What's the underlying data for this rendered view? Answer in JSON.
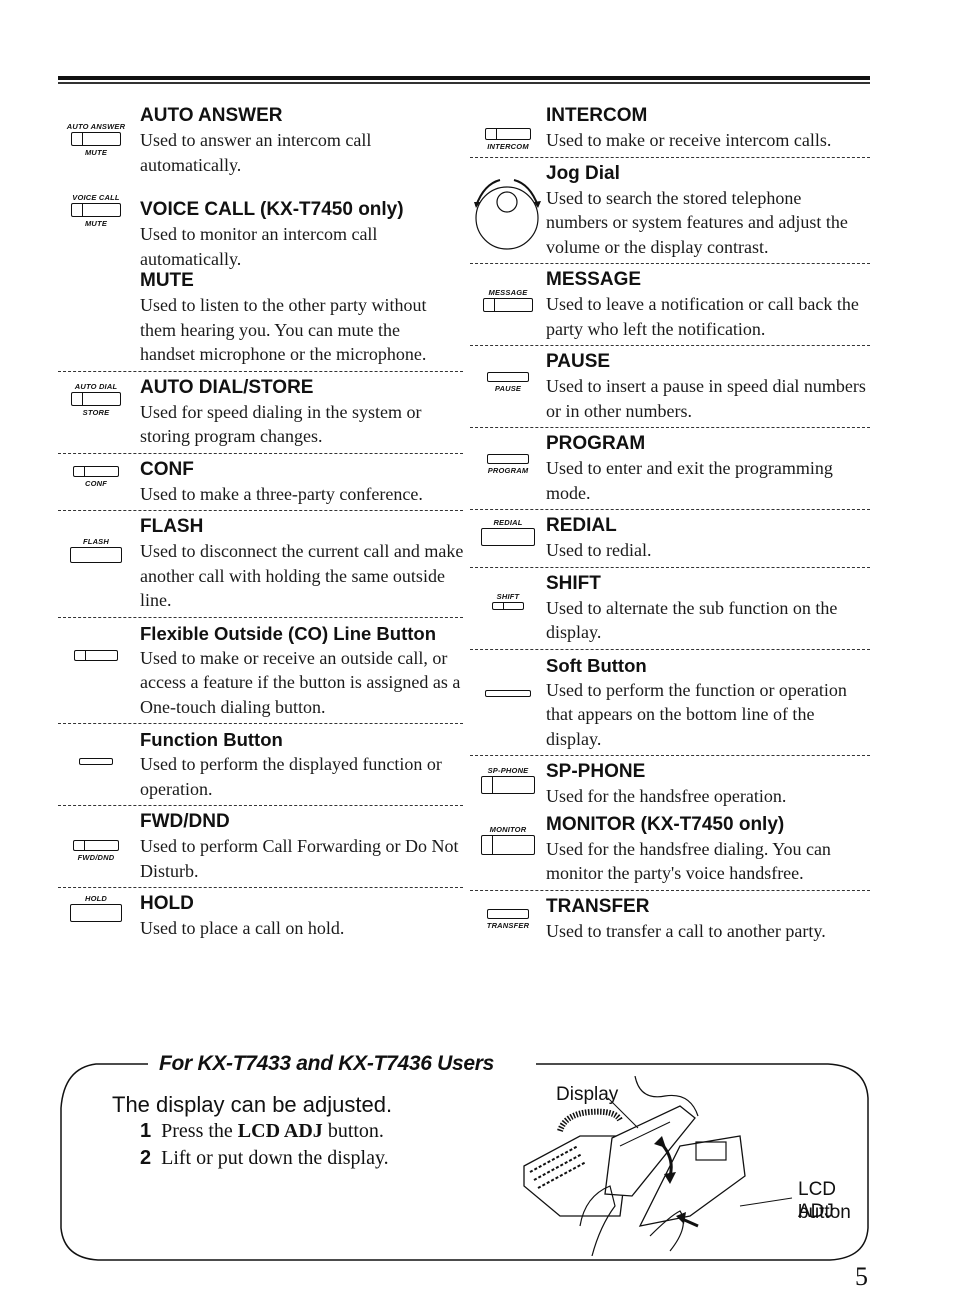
{
  "left_column": [
    {
      "id": "auto-answer",
      "icon_top_label": "AUTO ANSWER",
      "icon_bottom_label": "MUTE",
      "title": "AUTO ANSWER",
      "description": "Used to answer an intercom call automatically."
    },
    {
      "id": "voice-call",
      "icon_top_label": "VOICE CALL",
      "icon_bottom_label": "MUTE",
      "title": "VOICE CALL (KX-T7450 only)",
      "description": "Used to monitor an intercom call automatically."
    },
    {
      "id": "mute",
      "title": "MUTE",
      "description": "Used to listen to the other party without them hearing you. You can mute the handset microphone or the microphone."
    },
    {
      "id": "auto-dial-store",
      "icon_top_label": "AUTO DIAL",
      "icon_bottom_label": "STORE",
      "title": "AUTO DIAL/STORE",
      "description": "Used for speed dialing in the system or storing program changes."
    },
    {
      "id": "conf",
      "icon_bottom_label": "CONF",
      "title": "CONF",
      "description": "Used to make a three-party conference."
    },
    {
      "id": "flash",
      "icon_top_label": "FLASH",
      "title": "FLASH",
      "description": "Used to disconnect the current call and make another call with holding the same outside line."
    },
    {
      "id": "co-line",
      "title": "Flexible Outside (CO) Line Button",
      "description": "Used to make or receive an outside call, or access a feature if the button is assigned as a One-touch dialing button."
    },
    {
      "id": "function",
      "title": "Function Button",
      "description": "Used to perform the displayed function or operation."
    },
    {
      "id": "fwd-dnd",
      "icon_bottom_label": "FWD/DND",
      "title": "FWD/DND",
      "description": "Used to perform Call Forwarding or Do Not Disturb."
    },
    {
      "id": "hold",
      "icon_top_label": "HOLD",
      "title": "HOLD",
      "description": "Used to place a call on hold."
    }
  ],
  "right_column": [
    {
      "id": "intercom",
      "icon_bottom_label": "INTERCOM",
      "title": "INTERCOM",
      "description": "Used to make or receive intercom calls."
    },
    {
      "id": "jog-dial",
      "title": "Jog Dial",
      "description": "Used to search the stored telephone numbers or system features and adjust the volume or the display contrast."
    },
    {
      "id": "message",
      "icon_top_label": "MESSAGE",
      "title": "MESSAGE",
      "description": "Used to leave a notification or call back the party who left the notification."
    },
    {
      "id": "pause",
      "icon_bottom_label": "PAUSE",
      "title": "PAUSE",
      "description": "Used to insert a pause in speed dial numbers or in other numbers."
    },
    {
      "id": "program",
      "icon_bottom_label": "PROGRAM",
      "title": "PROGRAM",
      "description": "Used to enter and exit the programming mode."
    },
    {
      "id": "redial",
      "icon_top_label": "REDIAL",
      "title": "REDIAL",
      "description": "Used to redial."
    },
    {
      "id": "shift",
      "icon_top_label": "SHIFT",
      "title": "SHIFT",
      "description": "Used to alternate the sub function on the display."
    },
    {
      "id": "soft",
      "title": "Soft Button",
      "description": "Used to perform the function or operation that appears on the bottom line of the display."
    },
    {
      "id": "sp-phone",
      "icon_top_label": "SP-PHONE",
      "title": "SP-PHONE",
      "description": "Used for the handsfree operation."
    },
    {
      "id": "monitor",
      "icon_top_label": "MONITOR",
      "title": "MONITOR (KX-T7450 only)",
      "description": "Used for the handsfree dialing. You can monitor the party's voice handsfree."
    },
    {
      "id": "transfer",
      "icon_bottom_label": "TRANSFER",
      "title": "TRANSFER",
      "description": "Used to transfer a call to another party."
    }
  ],
  "tips_box": {
    "heading": "For KX-T7433 and KX-T7436 Users",
    "intro": "The display can be adjusted.",
    "steps": [
      {
        "num": "1",
        "pre": "Press the ",
        "bold": "LCD ADJ",
        "post": " button."
      },
      {
        "num": "2",
        "pre": "Lift or put down the display.",
        "bold": "",
        "post": ""
      }
    ],
    "illustration": {
      "label_display": "Display",
      "label_button_line1": "LCD ADJ",
      "label_button_line2": "button"
    }
  },
  "page_number": "5"
}
